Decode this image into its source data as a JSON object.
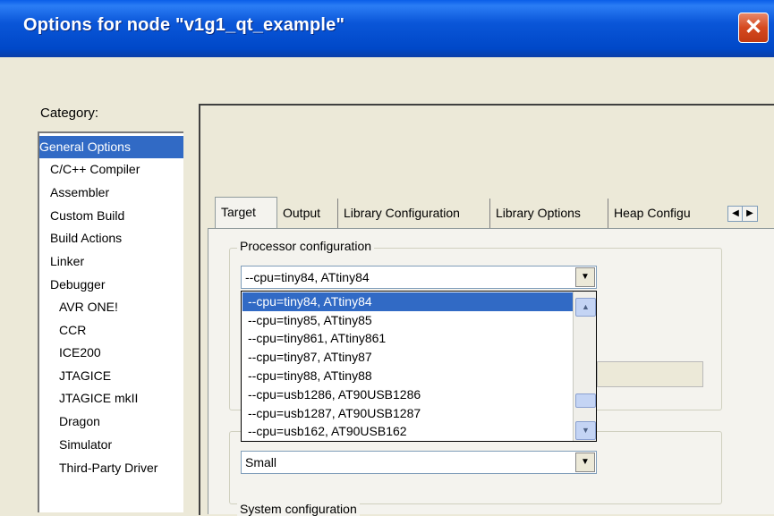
{
  "window": {
    "title": "Options for node \"v1g1_qt_example\"",
    "close_glyph": "✕"
  },
  "category": {
    "label": "Category:",
    "items": [
      "General Options",
      "C/C++ Compiler",
      "Assembler",
      "Custom Build",
      "Build Actions",
      "Linker",
      "Debugger",
      "AVR ONE!",
      "CCR",
      "ICE200",
      "JTAGICE",
      "JTAGICE mkII",
      "Dragon",
      "Simulator",
      "Third-Party Driver"
    ],
    "selected": "General Options"
  },
  "tabs": {
    "items": [
      "Target",
      "Output",
      "Library Configuration",
      "Library Options",
      "Heap Configu"
    ],
    "active": "Target",
    "scroll_left": "◀",
    "scroll_right": "▶"
  },
  "processor": {
    "group_label": "Processor configuration",
    "selected_value": "--cpu=tiny84,  ATtiny84",
    "dropdown_arrow": "▼",
    "options": [
      "--cpu=tiny84,  ATtiny84",
      "--cpu=tiny85,  ATtiny85",
      "--cpu=tiny861,  ATtiny861",
      "--cpu=tiny87,  ATtiny87",
      "--cpu=tiny88,  ATtiny88",
      "--cpu=usb1286,  AT90USB1286",
      "--cpu=usb1287,  AT90USB1287",
      "--cpu=usb162,   AT90USB162"
    ],
    "scroll_up": "▲",
    "scroll_down": "▼"
  },
  "memory_model": {
    "value": "Small",
    "dropdown_arrow": "▼"
  },
  "system": {
    "group_label": "System configuration"
  }
}
